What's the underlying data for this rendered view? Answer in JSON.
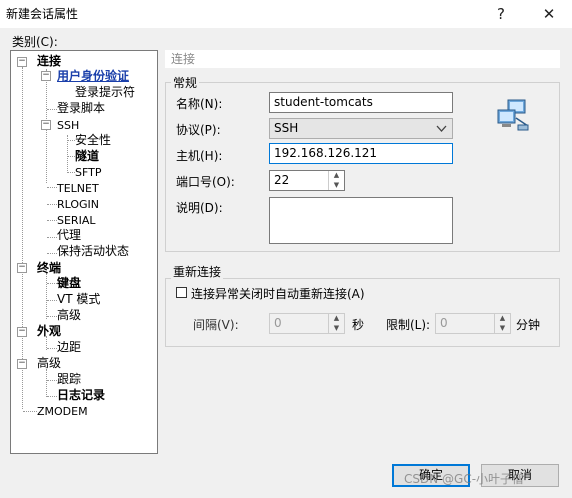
{
  "window": {
    "title": "新建会话属性",
    "help": "?",
    "close": "✕"
  },
  "category_label": "类别(C):",
  "tree": {
    "connection": "连接",
    "user_auth": "用户身份验证",
    "login_prompt": "登录提示符",
    "login_script": "登录脚本",
    "ssh": "SSH",
    "security": "安全性",
    "tunnel": "隧道",
    "sftp": "SFTP",
    "telnet": "TELNET",
    "rlogin": "RLOGIN",
    "serial": "SERIAL",
    "proxy": "代理",
    "keepalive": "保持活动状态",
    "terminal": "终端",
    "keyboard": "键盘",
    "vt_mode": "VT 模式",
    "advanced_t": "高级",
    "appearance": "外观",
    "margin": "边距",
    "advanced": "高级",
    "trace": "跟踪",
    "log": "日志记录",
    "zmodem": "ZMODEM"
  },
  "section_title": "连接",
  "general": {
    "group_label": "常规",
    "name_label": "名称(N):",
    "name_value": "student-tomcats",
    "protocol_label": "协议(P):",
    "protocol_value": "SSH",
    "host_label": "主机(H):",
    "host_value": "192.168.126.121",
    "port_label": "端口号(O):",
    "port_value": "22",
    "desc_label": "说明(D):",
    "desc_value": ""
  },
  "reconnect": {
    "group_label": "重新连接",
    "checkbox_label": "连接异常关闭时自动重新连接(A)",
    "checked": false,
    "interval_label": "间隔(V):",
    "interval_value": "0",
    "seconds": "秒",
    "limit_label": "限制(L):",
    "limit_value": "0",
    "minutes": "分钟"
  },
  "buttons": {
    "ok": "确定",
    "cancel": "取消"
  },
  "watermark": "CSDN @GC-小叶子僧",
  "colors": {
    "accent": "#0078d7",
    "selected_tree": "#1a3faa"
  }
}
